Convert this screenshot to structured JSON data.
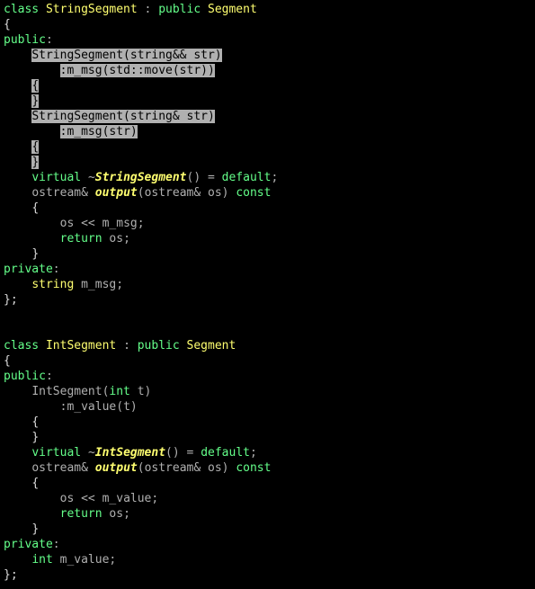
{
  "string_segment": {
    "line1_class": "class",
    "line1_name": "StringSegment",
    "line1_colon": " : ",
    "line1_public": "public",
    "line1_base": "Segment",
    "open_brace": "{",
    "public_label": "public",
    "ctor1_sig": "StringSegment(string&& str)",
    "ctor1_init": ":m_msg(std::move(str))",
    "ctor1_open": "{",
    "ctor1_close": "}",
    "ctor2_sig": "StringSegment(string& str)",
    "ctor2_init": ":m_msg(str)",
    "ctor2_open": "{",
    "ctor2_close": "}",
    "virtual_kw": "virtual",
    "tilde": "~",
    "dtor_name": "StringSegment",
    "dtor_rest": "() = ",
    "default_kw": "default",
    "output_ret": "ostream& ",
    "output_name": "output",
    "output_open_paren": "(",
    "output_param_type": "ostream& ",
    "output_param_name": "os",
    "output_close": ") ",
    "const_kw": "const",
    "out_open": "{",
    "out_body1a": "os << ",
    "out_body1b": "m_msg;",
    "out_body2_kw": "return",
    "out_body2_rest": " os;",
    "out_close": "}",
    "private_label": "private",
    "field_type": "string",
    "field_name": " m_msg;",
    "close_brace": "};"
  },
  "int_segment": {
    "line1_class": "class",
    "line1_name": "IntSegment",
    "line1_colon": " : ",
    "line1_public": "public",
    "line1_base": "Segment",
    "open_brace": "{",
    "public_label": "public",
    "ctor_sig_a": "IntSegment(",
    "ctor_sig_kw": "int",
    "ctor_sig_b": " t)",
    "ctor_init": ":m_value(t)",
    "ctor_open": "{",
    "ctor_close": "}",
    "virtual_kw": "virtual",
    "tilde": "~",
    "dtor_name": "IntSegment",
    "dtor_rest": "() = ",
    "default_kw": "default",
    "output_ret": "ostream& ",
    "output_name": "output",
    "output_open_paren": "(",
    "output_param_type": "ostream& ",
    "output_param_name": "os",
    "output_close": ") ",
    "const_kw": "const",
    "out_open": "{",
    "out_body1a": "os << ",
    "out_body1b": "m_value;",
    "out_body2_kw": "return",
    "out_body2_rest": " os;",
    "out_close": "}",
    "private_label": "private",
    "field_type": "int",
    "field_name": " m_value;",
    "close_brace": "};"
  }
}
